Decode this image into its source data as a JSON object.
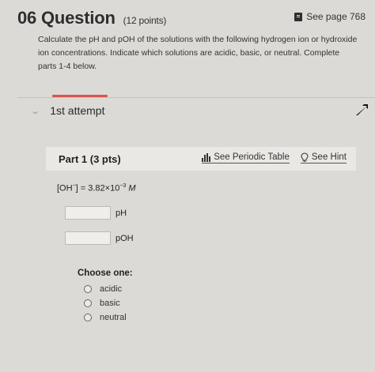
{
  "question": {
    "number": "06",
    "title": "Question",
    "points": "(12 points)",
    "see_page": "See page 768",
    "instructions": "Calculate the pH and pOH of the solutions with the following hydrogen ion or hydroxide ion concentrations. Indicate which solutions are acidic, basic, or neutral. Complete parts 1-4 below."
  },
  "attempt": {
    "label": "1st attempt"
  },
  "part": {
    "title": "Part 1 (3 pts)",
    "periodic_table_link": "See Periodic Table",
    "hint_link": "See Hint",
    "given_prefix": "[OH",
    "given_sup1": "−",
    "given_mid": "] = 3.82×10",
    "given_sup2": "−3",
    "given_unit": "M",
    "answers": [
      {
        "value": "",
        "unit": "pH"
      },
      {
        "value": "",
        "unit": "pOH"
      }
    ],
    "choose_label": "Choose one:",
    "options": [
      "acidic",
      "basic",
      "neutral"
    ]
  },
  "colors": {
    "accent": "#d9534f",
    "background": "#dcdad6"
  }
}
